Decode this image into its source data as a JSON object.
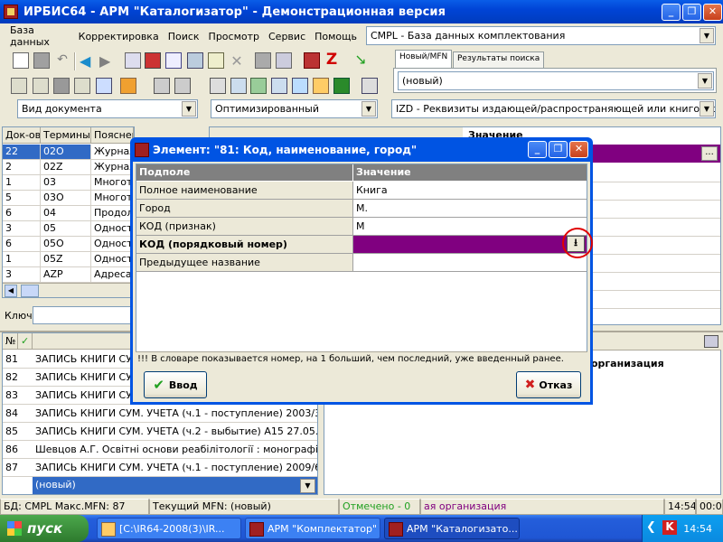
{
  "window": {
    "title": "ИРБИС64 - АРМ \"Каталогизатор\" - Демонстрационная версия"
  },
  "menu": [
    "База данных",
    "Корректировка",
    "Поиск",
    "Просмотр",
    "Сервис",
    "Помощь"
  ],
  "database_select": "CMPL - База данных комплектования",
  "tabs": [
    "Новый/MFN",
    "Результаты поиска"
  ],
  "mfn_select": "(новый)",
  "doc_type_select": "Вид документа",
  "mode_select": "Оптимизированный",
  "worksheet_select": "IZD - Реквизиты издающей/распространяющей или книготорговой",
  "dict_table": {
    "headers": [
      "Док-ов",
      "Термины",
      "Пояснен"
    ],
    "rows": [
      {
        "count": "22",
        "term": "02O",
        "expl": "Журнал"
      },
      {
        "count": "2",
        "term": "02Z",
        "expl": "Журнал"
      },
      {
        "count": "1",
        "term": "03",
        "expl": "Многото"
      },
      {
        "count": "5",
        "term": "03O",
        "expl": "Многото"
      },
      {
        "count": "6",
        "term": "04",
        "expl": "Продол"
      },
      {
        "count": "3",
        "term": "05",
        "expl": "Односто"
      },
      {
        "count": "6",
        "term": "05O",
        "expl": "Односто"
      },
      {
        "count": "1",
        "term": "05Z",
        "expl": "Односто"
      },
      {
        "count": "3",
        "term": "AZP",
        "expl": "Адреса"
      }
    ]
  },
  "key_label": "Ключ:",
  "record_list": {
    "header_no": "№",
    "rows": [
      {
        "no": "81",
        "text": "ЗАПИСЬ КНИГИ СУМ"
      },
      {
        "no": "82",
        "text": "ЗАПИСЬ КНИГИ СУМ"
      },
      {
        "no": "83",
        "text": "ЗАПИСЬ КНИГИ СУМ"
      },
      {
        "no": "84",
        "text": "ЗАПИСЬ КНИГИ СУМ. УЧЕТА (ч.1 - поступление)  2003/3"
      },
      {
        "no": "85",
        "text": "ЗАПИСЬ КНИГИ СУМ. УЧЕТА (ч.2 - выбытие)  A15 27.05.2"
      },
      {
        "no": "86",
        "text": "Шевцов А.Г. Освітні основи реабілітології : монографія/А"
      },
      {
        "no": "87",
        "text": "ЗАПИСЬ КНИГИ СУМ. УЧЕТА (ч.1 - поступление)  2009/69"
      }
    ],
    "new_row": "(новый)"
  },
  "right_panel": {
    "header_cell": "Значение",
    "org_text": "организация"
  },
  "dialog": {
    "title": "Элемент: \"81: Код, наименование, город\"",
    "col_subfield": "Подполе",
    "col_value": "Значение",
    "rows": [
      {
        "name": "Полное наименование",
        "value": "Книга"
      },
      {
        "name": "Город",
        "value": "М."
      },
      {
        "name": "КОД (признак)",
        "value": "М"
      },
      {
        "name": "КОД (порядковый номер)",
        "value": ""
      },
      {
        "name": "Предыдущее название",
        "value": ""
      }
    ],
    "hint": "!!! В словаре показывается номер, на 1 больший, чем последний, уже введенный ранее.",
    "ok_label": "Ввод",
    "cancel_label": "Отказ"
  },
  "status": {
    "db": "БД: CMPL Макс.MFN: 87",
    "current": "Текущий MFN: (новый)",
    "marked": "Отмечено - 0",
    "org": "ая организация",
    "time": "14:54",
    "time2": "00:00"
  },
  "taskbar": {
    "start": "пуск",
    "tasks": [
      "[C:\\IR64-2008(3)\\IR...",
      "АРМ \"Комплектатор\"",
      "АРМ \"Каталогизато..."
    ],
    "clock": "14:54"
  },
  "colors": {
    "purple_row": "#800080",
    "selection": "#316ac5",
    "xp_blue": "#0054e3",
    "highlight_circle": "#e00000"
  }
}
